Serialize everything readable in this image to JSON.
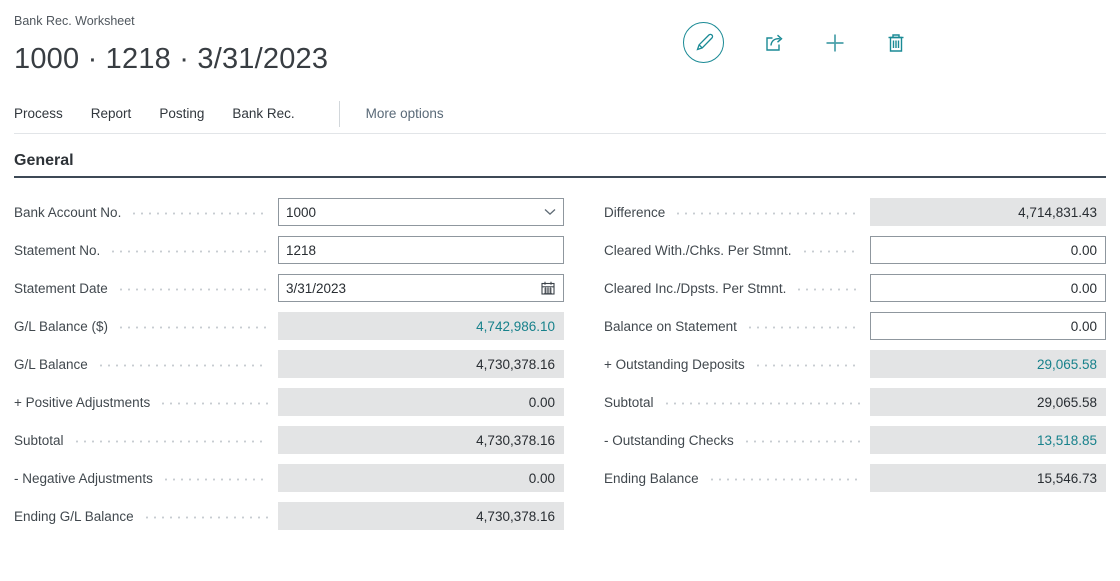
{
  "header": {
    "caption": "Bank Rec. Worksheet",
    "title": "1000 · 1218 · 3/31/2023"
  },
  "toolbar": {
    "buttons": [
      {
        "name": "edit",
        "icon": "pencil-icon"
      },
      {
        "name": "share",
        "icon": "share-icon"
      },
      {
        "name": "add",
        "icon": "plus-icon"
      },
      {
        "name": "delete",
        "icon": "trash-icon"
      }
    ]
  },
  "menu": {
    "items": [
      "Process",
      "Report",
      "Posting",
      "Bank Rec."
    ],
    "more_label": "More options"
  },
  "section": {
    "title": "General"
  },
  "colors": {
    "accent_teal": "#1a8a95",
    "link_teal": "#17818b",
    "readonly_field_bg": "#e3e4e5",
    "section_underline": "#3d4956"
  },
  "fields": {
    "left": [
      {
        "label": "Bank Account No.",
        "value": "1000",
        "type": "lookup",
        "numeric": false
      },
      {
        "label": "Statement No.",
        "value": "1218",
        "type": "text",
        "numeric": false
      },
      {
        "label": "Statement Date",
        "value": "3/31/2023",
        "type": "date",
        "numeric": false
      },
      {
        "label": "G/L Balance ($)",
        "value": "4,742,986.10",
        "type": "link",
        "numeric": true
      },
      {
        "label": "G/L Balance",
        "value": "4,730,378.16",
        "type": "readonly",
        "numeric": true
      },
      {
        "label": "+ Positive Adjustments",
        "value": "0.00",
        "type": "readonly",
        "numeric": true
      },
      {
        "label": "Subtotal",
        "value": "4,730,378.16",
        "type": "readonly",
        "numeric": true
      },
      {
        "label": "- Negative Adjustments",
        "value": "0.00",
        "type": "readonly",
        "numeric": true
      },
      {
        "label": "Ending G/L Balance",
        "value": "4,730,378.16",
        "type": "readonly",
        "numeric": true
      }
    ],
    "right": [
      {
        "label": "Difference",
        "value": "4,714,831.43",
        "type": "readonly",
        "numeric": true
      },
      {
        "label": "Cleared With./Chks. Per Stmnt.",
        "value": "0.00",
        "type": "number",
        "numeric": true
      },
      {
        "label": "Cleared Inc./Dpsts. Per Stmnt.",
        "value": "0.00",
        "type": "number",
        "numeric": true
      },
      {
        "label": "Balance on Statement",
        "value": "0.00",
        "type": "number",
        "numeric": true
      },
      {
        "label": "+ Outstanding Deposits",
        "value": "29,065.58",
        "type": "link",
        "numeric": true
      },
      {
        "label": "Subtotal",
        "value": "29,065.58",
        "type": "readonly",
        "numeric": true
      },
      {
        "label": "- Outstanding Checks",
        "value": "13,518.85",
        "type": "link",
        "numeric": true
      },
      {
        "label": "Ending Balance",
        "value": "15,546.73",
        "type": "readonly",
        "numeric": true
      }
    ]
  }
}
